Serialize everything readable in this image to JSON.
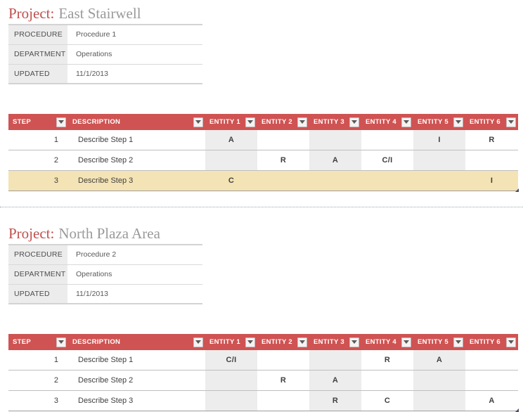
{
  "sections": [
    {
      "header": {
        "project_label": "Project:",
        "project_value": "East Stairwell",
        "info_rows": [
          {
            "key": "PROCEDURE",
            "value": "Procedure 1"
          },
          {
            "key": "DEPARTMENT",
            "value": "Operations"
          },
          {
            "key": "UPDATED",
            "value": "11/1/2013"
          }
        ]
      },
      "table": {
        "columns": [
          "STEP",
          "DESCRIPTION",
          "ENTITY 1",
          "ENTITY 2",
          "ENTITY 3",
          "ENTITY 4",
          "ENTITY 5",
          "ENTITY 6"
        ],
        "rows": [
          {
            "highlighted": false,
            "step": "1",
            "description": "Describe Step 1",
            "entities": [
              "A",
              "",
              "",
              "",
              "I",
              "R"
            ]
          },
          {
            "highlighted": false,
            "step": "2",
            "description": "Describe Step 2",
            "entities": [
              "",
              "R",
              "A",
              "C/I",
              "",
              ""
            ]
          },
          {
            "highlighted": true,
            "step": "3",
            "description": "Describe Step 3",
            "entities": [
              "C",
              "",
              "",
              "",
              "",
              "I"
            ]
          }
        ]
      }
    },
    {
      "header": {
        "project_label": "Project:",
        "project_value": "North Plaza Area",
        "info_rows": [
          {
            "key": "PROCEDURE",
            "value": "Procedure 2"
          },
          {
            "key": "DEPARTMENT",
            "value": "Operations"
          },
          {
            "key": "UPDATED",
            "value": "11/1/2013"
          }
        ]
      },
      "table": {
        "columns": [
          "STEP",
          "DESCRIPTION",
          "ENTITY 1",
          "ENTITY 2",
          "ENTITY 3",
          "ENTITY 4",
          "ENTITY 5",
          "ENTITY 6"
        ],
        "rows": [
          {
            "highlighted": false,
            "step": "1",
            "description": "Describe Step 1",
            "entities": [
              "C/I",
              "",
              "",
              "R",
              "A",
              ""
            ]
          },
          {
            "highlighted": false,
            "step": "2",
            "description": "Describe Step 2",
            "entities": [
              "",
              "R",
              "A",
              "",
              "",
              ""
            ]
          },
          {
            "highlighted": false,
            "step": "3",
            "description": "Describe Step 3",
            "entities": [
              "",
              "",
              "R",
              "C",
              "",
              "A"
            ]
          }
        ]
      }
    }
  ],
  "icons": {
    "filter_dropdown": "chevron-down-icon",
    "resize_grip": "resize-handle-icon"
  },
  "colors": {
    "header_red": "#cf5352",
    "highlight_row": "#f4e3b4",
    "band_gray": "#ededed",
    "label_gray": "#ececec",
    "project_label_red": "#c0504d",
    "project_value_gray": "#9a9a9a"
  }
}
